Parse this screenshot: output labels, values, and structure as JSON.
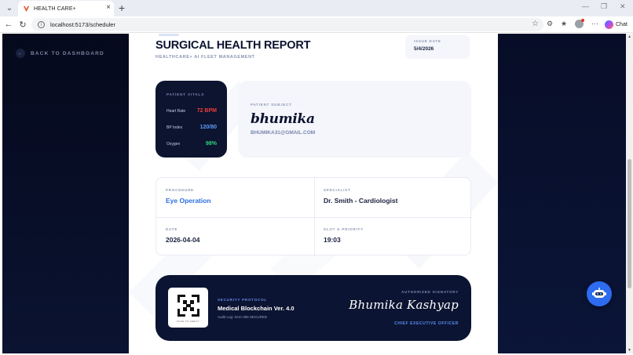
{
  "browser": {
    "tab_title": "HEALTH CARE+",
    "url": "localhost:5173/scheduler",
    "chat_label": "Chat"
  },
  "sidebar": {
    "back_label": "BACK TO DASHBOARD"
  },
  "report": {
    "title": "SURGICAL HEALTH REPORT",
    "subtitle": "HEALTHCARE+ AI FLEET MANAGEMENT",
    "issue_date_label": "ISSUE DATE",
    "issue_date_value": "5/4/2026",
    "vitals": {
      "title": "PATIENT VITALS",
      "heart_rate_label": "Heart Rate",
      "heart_rate_value": "72 BPM",
      "bp_label": "BP Index",
      "bp_value": "120/80",
      "oxygen_label": "Oxygen",
      "oxygen_value": "98%"
    },
    "subject": {
      "label": "PATIENT SUBJECT",
      "name": "bhumika",
      "email": "BHUMIKA31@GMAIL.COM"
    },
    "details": {
      "procedure_label": "PROCEDURE",
      "procedure_value": "Eye Operation",
      "specialist_label": "SPECIALIST",
      "specialist_value": "Dr. Smith - Cardiologist",
      "date_label": "DATE",
      "date_value": "2026-04-04",
      "slot_label": "SLOT & PRIORITY",
      "slot_value": "19:03"
    },
    "footer": {
      "qr_caption": "SCAN TO VERIFY",
      "protocol_label": "SECURITY PROTOCOL",
      "protocol_name": "Medical Blockchain Ver. 4.0",
      "audit": "Audit Log: SHA-256 SECURED",
      "signatory_label": "AUTHORIZED SIGNATORY",
      "signatory_name": "Bhumika Kashyap",
      "signatory_title": "CHIEF EXECUTIVE OFFICER"
    }
  },
  "colors": {
    "heart_rate": "#f03b3b",
    "bp": "#5b9bf5",
    "oxygen": "#2fd47a",
    "accent_blue": "#2f6fe0",
    "navy": "#0b1432"
  },
  "icons": [
    "tab-list-icon",
    "favicon-icon",
    "close-icon",
    "plus-icon",
    "back-icon",
    "reload-icon",
    "info-icon",
    "star-icon",
    "extensions-icon",
    "favorites-icon",
    "profile-icon",
    "more-icon",
    "copilot-icon",
    "arrow-left-icon",
    "qr-icon",
    "robot-icon"
  ]
}
